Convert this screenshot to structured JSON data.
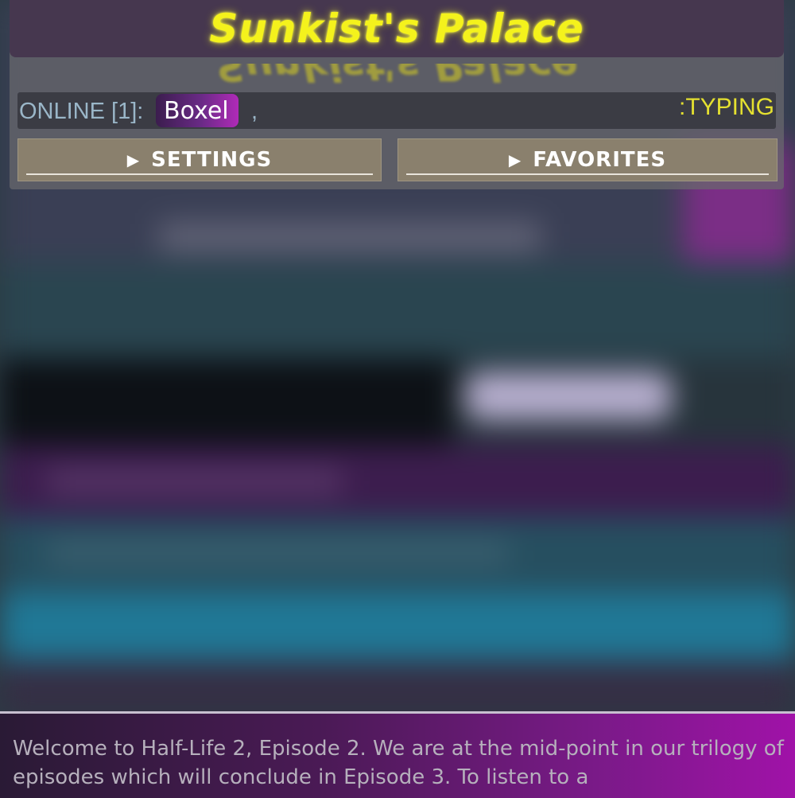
{
  "header": {
    "title": "Sunkist's Palace",
    "online_label": "ONLINE [1]:",
    "online_users": [
      "Boxel"
    ],
    "separator": ",",
    "typing_label": ":TYPING"
  },
  "buttons": {
    "settings": "SETTINGS",
    "favorites": "FAVORITES",
    "expand_glyph": "▶"
  },
  "message": {
    "text": "Welcome to Half-Life 2, Episode 2. We are at the mid-point in our trilogy of episodes which will conclude in Episode 3. To listen to a"
  },
  "colors": {
    "title": "#f4f21c",
    "typing": "#e4e030",
    "online_label": "#9ab6c8",
    "button_bg": "#8a806d",
    "title_bar": "#46374f"
  }
}
